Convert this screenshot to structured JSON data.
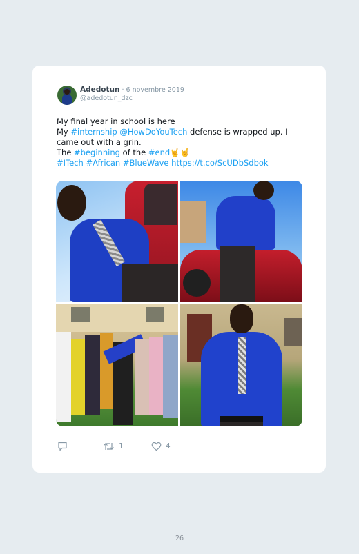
{
  "tweet": {
    "author_name": "Adedotun",
    "date": " · 6 novembre 2019",
    "handle": "@adedotun_dzc",
    "line1": "My final year in school is here",
    "line2_prefix": "My ",
    "tag_internship": "#internship",
    "mention": "@HowDoYouTech",
    "line2_suffix": " defense is wrapped up. I came out with a grin.",
    "line3_prefix": "The ",
    "tag_beginning": "#beginning",
    "line3_mid": " of the ",
    "tag_end": "#end",
    "line3_emoji": "🤘🤘",
    "tag_itech": "#ITech",
    "tag_african": "#African",
    "tag_bluewave": "#BlueWave",
    "url": "https://t.co/ScUDbSdbok"
  },
  "actions": {
    "reply_icon": "reply-icon",
    "retweet_icon": "retweet-icon",
    "retweet_count": "1",
    "like_icon": "heart-icon",
    "like_count": "4"
  },
  "colors": {
    "link": "#1da1f2",
    "background": "#e6ecf0",
    "card": "#ffffff"
  },
  "page": {
    "number": "26"
  }
}
